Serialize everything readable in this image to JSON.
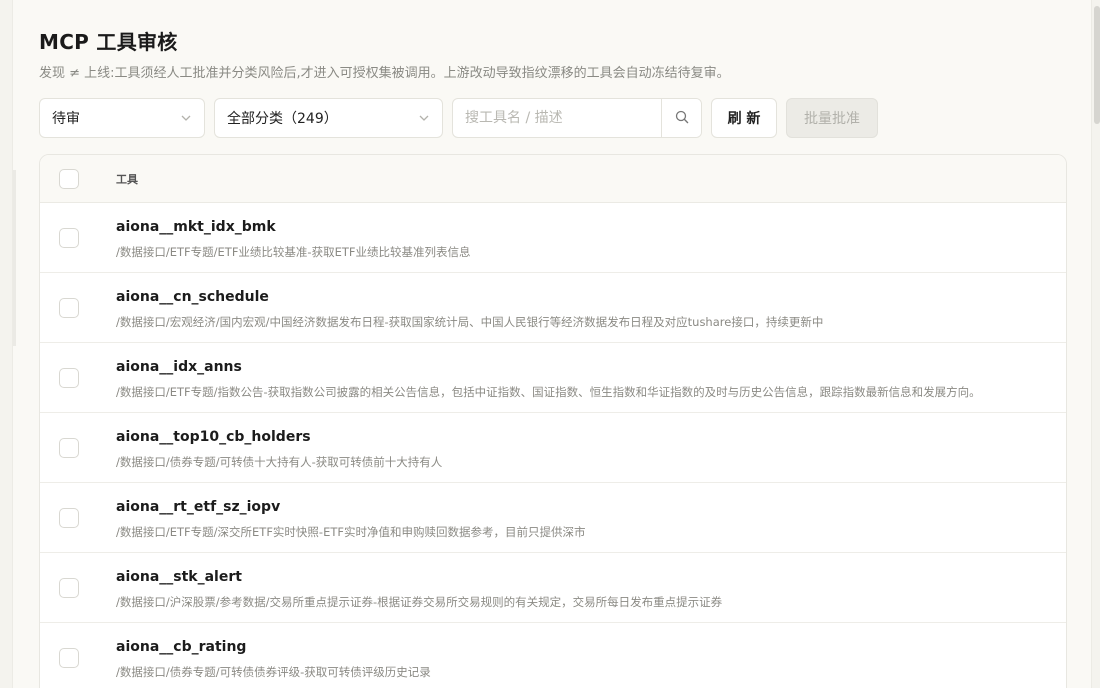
{
  "header": {
    "title": "MCP 工具审核",
    "subtitle": "发现 ≠ 上线:工具须经人工批准并分类风险后,才进入可授权集被调用。上游改动导致指纹漂移的工具会自动冻结待复审。"
  },
  "filters": {
    "status": {
      "selected": "待审",
      "icon": "chevron-down-icon"
    },
    "category": {
      "selected": "全部分类（249）",
      "icon": "chevron-down-icon"
    },
    "search": {
      "value": "",
      "placeholder": "搜工具名 / 描述",
      "icon": "search-icon"
    },
    "refresh_label": "刷 新",
    "batch_approve_label": "批量批准"
  },
  "table": {
    "column_header": "工具",
    "rows": [
      {
        "name": "aiona__mkt_idx_bmk",
        "desc": "/数据接口/ETF专题/ETF业绩比较基准-获取ETF业绩比较基准列表信息"
      },
      {
        "name": "aiona__cn_schedule",
        "desc": "/数据接口/宏观经济/国内宏观/中国经济数据发布日程-获取国家统计局、中国人民银行等经济数据发布日程及对应tushare接口，持续更新中"
      },
      {
        "name": "aiona__idx_anns",
        "desc": "/数据接口/ETF专题/指数公告-获取指数公司披露的相关公告信息，包括中证指数、国证指数、恒生指数和华证指数的及时与历史公告信息，跟踪指数最新信息和发展方向。"
      },
      {
        "name": "aiona__top10_cb_holders",
        "desc": "/数据接口/债券专题/可转债十大持有人-获取可转债前十大持有人"
      },
      {
        "name": "aiona__rt_etf_sz_iopv",
        "desc": "/数据接口/ETF专题/深交所ETF实时快照-ETF实时净值和申购赎回数据参考，目前只提供深市"
      },
      {
        "name": "aiona__stk_alert",
        "desc": "/数据接口/沪深股票/参考数据/交易所重点提示证券-根据证券交易所交易规则的有关规定，交易所每日发布重点提示证券"
      },
      {
        "name": "aiona__cb_rating",
        "desc": "/数据接口/债券专题/可转债债券评级-获取可转债评级历史记录"
      }
    ]
  }
}
